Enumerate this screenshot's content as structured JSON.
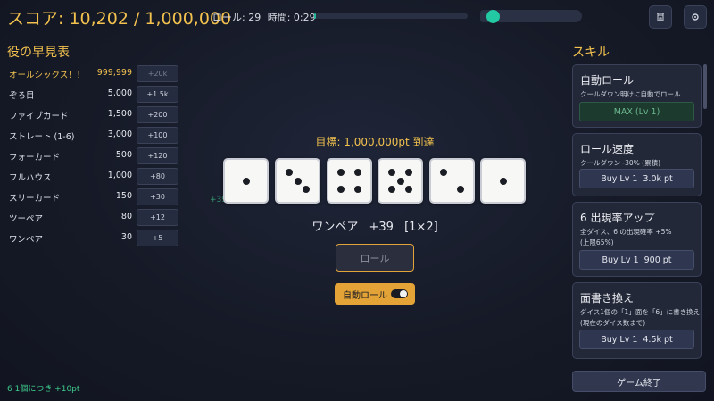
{
  "header": {
    "score_label": "スコア: 10,202 / 1,000,000",
    "roll_label": "ロール: 29",
    "time_label": "時間: 0:29",
    "time_progress": 0.01,
    "speed_slider": 0.06,
    "shop_icon": "shop-icon",
    "settings_icon": "gear-icon"
  },
  "left": {
    "title": "役の早見表",
    "yaku": [
      {
        "name": "オールシックス！！",
        "value": "999,999",
        "bonus": "+20k"
      },
      {
        "name": "ぞろ目",
        "value": "5,000",
        "bonus": "+1.5k"
      },
      {
        "name": "ファイブカード",
        "value": "1,500",
        "bonus": "+200"
      },
      {
        "name": "ストレート (1-6)",
        "value": "3,000",
        "bonus": "+100"
      },
      {
        "name": "フォーカード",
        "value": "500",
        "bonus": "+120"
      },
      {
        "name": "フルハウス",
        "value": "1,000",
        "bonus": "+80"
      },
      {
        "name": "スリーカード",
        "value": "150",
        "bonus": "+30"
      },
      {
        "name": "ツーペア",
        "value": "80",
        "bonus": "+12"
      },
      {
        "name": "ワンペア",
        "value": "30",
        "bonus": "+5"
      }
    ],
    "footer": "6 1個につき +10pt"
  },
  "center": {
    "target": "目標: 1,000,000pt 到達",
    "dice": [
      1,
      3,
      4,
      5,
      2,
      1
    ],
    "float_bonus": "+39",
    "result_name": "ワンペア",
    "result_points": "+39",
    "result_mult": "[1×2]",
    "roll_button": "ロール",
    "auto_roll_label": "自動ロール",
    "auto_roll_on": true
  },
  "right": {
    "title": "スキル",
    "skills": [
      {
        "name": "自動ロール",
        "desc": "クールダウン明けに自動でロール",
        "button": "MAX (Lv 1)",
        "max": true
      },
      {
        "name": "ロール速度",
        "desc": "クールダウン -30% (累積)",
        "buy": "Buy Lv 1",
        "cost": "3.0k pt"
      },
      {
        "name": "6 出現率アップ",
        "desc": "全ダイス、6 の出現確率 +5%\n(上限65%)",
        "buy": "Buy Lv 1",
        "cost": "900 pt"
      },
      {
        "name": "面書き換え",
        "desc": "ダイス1個の「1」面を「6」に書き換え\n(現在のダイス数まで)",
        "buy": "Buy Lv 1",
        "cost": "4.5k pt"
      }
    ],
    "end_button": "ゲーム終了"
  },
  "colors": {
    "accent": "#f2c14e",
    "teal": "#22c9a3",
    "green": "#3ecf8e",
    "button_orange": "#e3a336"
  }
}
